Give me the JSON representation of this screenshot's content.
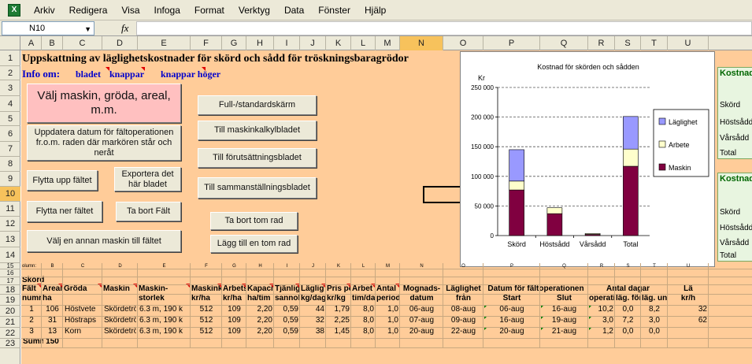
{
  "menu": [
    "Arkiv",
    "Redigera",
    "Visa",
    "Infoga",
    "Format",
    "Verktyg",
    "Data",
    "Fönster",
    "Hjälp"
  ],
  "formula": {
    "cell": "N10",
    "fx": "fx",
    "value": ""
  },
  "columns": [
    "A",
    "B",
    "C",
    "D",
    "E",
    "F",
    "G",
    "H",
    "I",
    "J",
    "K",
    "L",
    "M",
    "N",
    "O",
    "P",
    "Q",
    "R",
    "S",
    "T",
    "U"
  ],
  "selected_column": "N",
  "rows": [
    "1",
    "2",
    "3",
    "4",
    "5",
    "6",
    "7",
    "8",
    "9",
    "10",
    "11",
    "12",
    "13",
    "14",
    "15",
    "16",
    "17",
    "18",
    "19",
    "20",
    "21",
    "22",
    "23"
  ],
  "selected_row": "10",
  "sheet": {
    "title": "Uppskattning av läglighetskostnader för skörd och sådd  för tröskningsbaragrödor",
    "info_label": "Info om:",
    "info_links": [
      "bladet",
      "knappar",
      "knappar höger"
    ]
  },
  "buttons": {
    "valj_maskin": "Välj maskin, gröda, areal, m.m.",
    "uppdatera": "Uppdatera datum för fältoperationen fr.o.m. raden där markören står och neråt",
    "flytta_upp": "Flytta upp fältet",
    "exportera": "Exportera det här bladet",
    "flytta_ner": "Flytta ner fältet",
    "ta_bort_falt": "Ta bort Fält",
    "valj_annan": "Välj en annan maskin till fältet",
    "fullskarm": "Full-/standardskärm",
    "maskinkalkyl": "Till maskinkalkylbladet",
    "forutsattning": "Till förutsättningsbladet",
    "sammanstallning": "Till sammanställningsbladet",
    "ta_bort_rad": "Ta bort tom rad",
    "lagg_till_rad": "Lägg till en tom rad"
  },
  "right_panels": [
    {
      "title": "Kostnad",
      "lines": [
        "Skörd",
        "Höstsådd",
        "Vårsådd",
        "Total"
      ]
    },
    {
      "title": "Kostnad",
      "lines": [
        "Skörd",
        "Höstsådd",
        "Vårsådd",
        "Total"
      ]
    }
  ],
  "chart_data": {
    "type": "bar",
    "stacked": true,
    "title": "Kostnad för skörden och sådden",
    "ylabel": "Kr",
    "categories": [
      "Skörd",
      "Höstsådd",
      "Vårsådd",
      "Total"
    ],
    "series": [
      {
        "name": "Maskin",
        "color": "#800040",
        "values": [
          77000,
          37000,
          2000,
          117000
        ]
      },
      {
        "name": "Arbete",
        "color": "#ffffcc",
        "values": [
          15000,
          10000,
          1500,
          29000
        ]
      },
      {
        "name": "Läglighet",
        "color": "#9999ff",
        "values": [
          53000,
          0,
          0,
          55000
        ]
      }
    ],
    "ylim": [
      0,
      250000
    ],
    "yticks": [
      "0",
      "50 000",
      "100 000",
      "150 000",
      "200 000",
      "250 000"
    ],
    "grid": true,
    "legend": "right",
    "legend_order": [
      "Läglighet",
      "Arbete",
      "Maskin"
    ]
  },
  "table": {
    "row15_labels": [
      "olumn:",
      "B",
      "C",
      "D",
      "E",
      "F",
      "G",
      "H",
      "I",
      "J",
      "K",
      "L",
      "M",
      "N",
      "O",
      "P",
      "Q",
      "R",
      "S",
      "T",
      "U"
    ],
    "section": "Skörd",
    "header1": [
      "Fält",
      "Areal",
      "Gröda",
      "Maskin",
      "Maskin-",
      "Maskinko",
      "Arbets",
      "Kapacit",
      "Tjänlig",
      "Läglig",
      "Pris pe",
      "Arbet",
      "Antal",
      "Mognads-",
      "Läglighet",
      "Datum för fältoperationen",
      "Antal dagar",
      "Lä"
    ],
    "header2": [
      "numr",
      "ha",
      "",
      "",
      "storlek",
      "kr/ha",
      "kr/ha",
      "ha/tim",
      "sannoli",
      "kg/dag",
      "kr/kg",
      "tim/dag",
      "period",
      "datum",
      "från",
      "Start",
      "Slut",
      "operatio",
      "läg. före",
      "läg. under",
      "kr/h"
    ],
    "rows": [
      [
        "1",
        "106",
        "Höstvete",
        "Skördetrö",
        "6.3 m, 190 k",
        "512",
        "109",
        "2,20",
        "0,59",
        "44",
        "1,79",
        "8,0",
        "1,0",
        "06-aug",
        "08-aug",
        "06-aug",
        "16-aug",
        "10,2",
        "0,0",
        "8,2",
        "32"
      ],
      [
        "2",
        "31",
        "Höstraps",
        "Skördetrö",
        "6.3 m, 190 k",
        "512",
        "109",
        "2,20",
        "0,59",
        "32",
        "2,25",
        "8,0",
        "1,0",
        "07-aug",
        "09-aug",
        "16-aug",
        "19-aug",
        "3,0",
        "7,2",
        "3,0",
        "62"
      ],
      [
        "3",
        "13",
        "Korn",
        "Skördetrö",
        "6.3 m, 190 k",
        "512",
        "109",
        "2,20",
        "0,59",
        "38",
        "1,45",
        "8,0",
        "1,0",
        "20-aug",
        "22-aug",
        "20-aug",
        "21-aug",
        "1,2",
        "0,0",
        "0,0",
        ""
      ]
    ],
    "sum_label": "Summ",
    "sum_value": "150"
  }
}
